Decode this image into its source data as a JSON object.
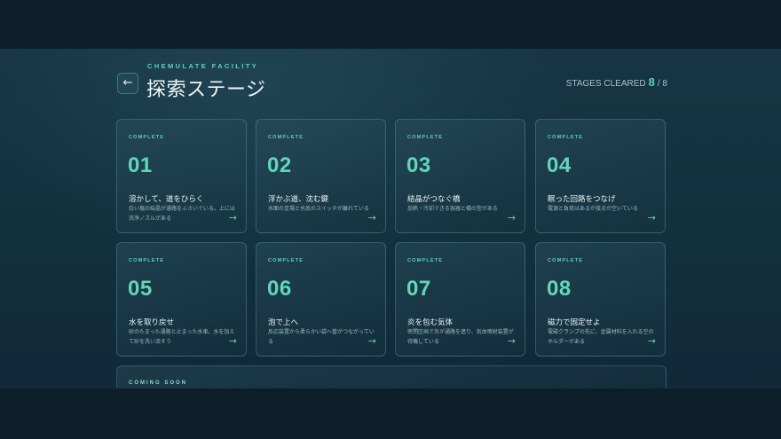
{
  "header": {
    "back_icon": "←",
    "facility": "CHEMULATE FACILITY",
    "title": "探索ステージ",
    "cleared_label": "STAGES CLEARED",
    "cleared_count": "8",
    "cleared_total": "/ 8"
  },
  "stages": [
    {
      "status": "COMPLETE",
      "number": "01",
      "title": "溶かして、道をひらく",
      "desc": "白い塩の結晶が通路をふさいでいる。上には洗浄ノズルがある",
      "arrow": "→"
    },
    {
      "status": "COMPLETE",
      "number": "02",
      "title": "浮かぶ道、沈む鍵",
      "desc": "水面の足場と水底のスイッチが離れている",
      "arrow": "→"
    },
    {
      "status": "COMPLETE",
      "number": "03",
      "title": "結晶がつなぐ橋",
      "desc": "加熱・冷却できる容器と橋の型がある",
      "arrow": "→"
    },
    {
      "status": "COMPLETE",
      "number": "04",
      "title": "眠った回路をつなげ",
      "desc": "電源と負荷はあるが接点が空いている",
      "arrow": "→"
    },
    {
      "status": "COMPLETE",
      "number": "05",
      "title": "水を取り戻せ",
      "desc": "砂のたまった通路と止まった水車。水を加えて砂を洗い流そう",
      "arrow": "→"
    },
    {
      "status": "COMPLETE",
      "number": "06",
      "title": "泡で上へ",
      "desc": "反応装置から柔らかい袋へ管がつながっている",
      "arrow": "→"
    },
    {
      "status": "COMPLETE",
      "number": "07",
      "title": "炎を包む気体",
      "desc": "密閉区画で炎が通路を遮り、気体噴射装置が待機している",
      "arrow": "→"
    },
    {
      "status": "COMPLETE",
      "number": "08",
      "title": "磁力で固定せよ",
      "desc": "電磁クランプの先に、金属材料を入れる空のホルダーがある",
      "arrow": "→"
    }
  ],
  "coming_soon": {
    "label": "COMING SOON"
  },
  "colors": {
    "accent": "#5fd3b8",
    "background": "#0d1e2b",
    "panel": "#173544"
  }
}
